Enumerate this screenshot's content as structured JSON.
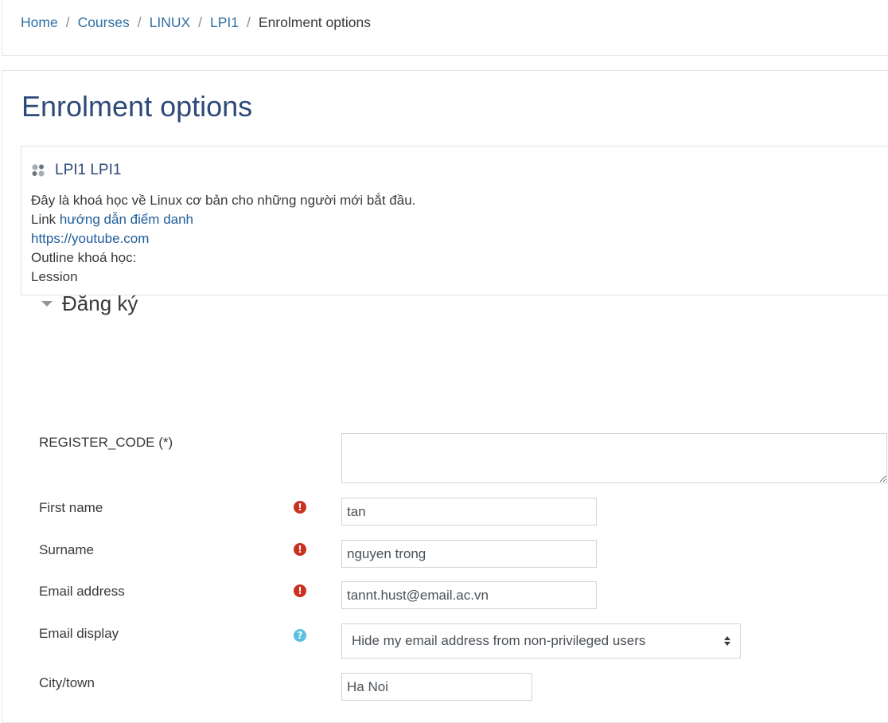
{
  "breadcrumb": {
    "items": [
      "Home",
      "Courses",
      "LINUX",
      "LPI1"
    ],
    "current": "Enrolment options",
    "separator": "/"
  },
  "page": {
    "title": "Enrolment options"
  },
  "course": {
    "name": "LPI1 LPI1",
    "summary": {
      "line1": "Đây là khoá học về Linux cơ bản cho những người mới bắt đầu.",
      "line2_prefix": "Link ",
      "line2_link": "hướng dẫn điểm danh",
      "line3_link": "https://youtube.com",
      "line4": "Outline khoá học:",
      "line5": "Lession"
    }
  },
  "form": {
    "section_title": "Đăng ký",
    "register_code": {
      "label": "REGISTER_CODE (*)",
      "value": ""
    },
    "first_name": {
      "label": "First name",
      "value": "tan"
    },
    "surname": {
      "label": "Surname",
      "value": "nguyen trong"
    },
    "email": {
      "label": "Email address",
      "value": "tannt.hust@email.ac.vn"
    },
    "email_display": {
      "label": "Email display",
      "selected": "Hide my email address from non-privileged users"
    },
    "city": {
      "label": "City/town",
      "value": "Ha Noi"
    }
  },
  "icons": {
    "required": "exclamation-circle-icon",
    "help": "question-circle-icon",
    "course": "course-icon",
    "collapse": "caret-down-icon"
  },
  "colors": {
    "link": "#2f6fa3",
    "title": "#2e4a78",
    "error": "#ca3120",
    "help": "#5bc0de"
  }
}
